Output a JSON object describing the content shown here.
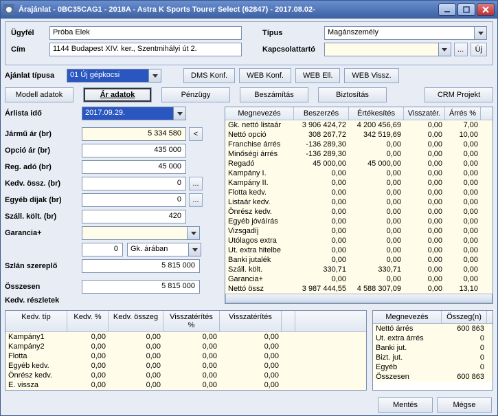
{
  "window": {
    "title": "Árajánlat - 0BC35CAG1 - 2018A - Astra K Sports Tourer Select (62847) - 2017.08.02-"
  },
  "top": {
    "customer_label": "Ügyfél",
    "customer_value": "Próba Elek",
    "address_label": "Cím",
    "address_value": "1144 Budapest XIV. ker., Szentmihályi út 2.",
    "type_label": "Típus",
    "type_value": "Magánszemély",
    "contact_label": "Kapcsolattartó",
    "contact_value": "",
    "dots": "...",
    "new": "Új"
  },
  "ajrow": {
    "label": "Ajánlat típusa",
    "value": "01 Új gépkocsi",
    "buttons": [
      "DMS Konf.",
      "WEB Konf.",
      "WEB Ell.",
      "WEB Vissz."
    ]
  },
  "tabs": {
    "items": [
      "Modell adatok",
      "Ár adatok",
      "Pénzügy",
      "Beszámítás",
      "Biztosítás"
    ],
    "right": "CRM Projekt"
  },
  "left": {
    "arlista_label": "Árlista idő",
    "arlista_value": "2017.09.29.",
    "fields": [
      {
        "label": "Jármű ár (br)",
        "value": "5 334 580",
        "extra": "<"
      },
      {
        "label": "Opció ár (br)",
        "value": "435 000"
      },
      {
        "label": "Reg. adó (br)",
        "value": "45 000"
      },
      {
        "label": "Kedv. össz. (br)",
        "value": "0",
        "extra": "..."
      },
      {
        "label": "Egyéb díjak (br)",
        "value": "0",
        "extra": "..."
      },
      {
        "label": "Száll. költ. (br)",
        "value": "420"
      }
    ],
    "garancia_label": "Garancia+",
    "garancia_value": "",
    "garancia_num": "0",
    "garancia_combo": "Gk. árában",
    "szlan_label": "Szlán szereplő",
    "szlan_value": "5 815 000",
    "ossz_label": "Összesen",
    "ossz_value": "5 815 000",
    "kedv_label": "Kedv. részletek"
  },
  "grid": {
    "headers": [
      "Megnevezés",
      "Beszerzés",
      "Értékesítés",
      "Visszatér.",
      "Árrés %"
    ],
    "rows": [
      [
        "Gk. nettó listaár",
        "3 906 424,72",
        "4 200 456,69",
        "0,00",
        "7,00"
      ],
      [
        "Nettó opció",
        "308 267,72",
        "342 519,69",
        "0,00",
        "10,00"
      ],
      [
        "Franchise árrés",
        "-136 289,30",
        "0,00",
        "0,00",
        "0,00"
      ],
      [
        "Minőségi árrés",
        "-136 289,30",
        "0,00",
        "0,00",
        "0,00"
      ],
      [
        "Regadó",
        "45 000,00",
        "45 000,00",
        "0,00",
        "0,00"
      ],
      [
        "Kampány I.",
        "0,00",
        "0,00",
        "0,00",
        "0,00"
      ],
      [
        "Kampány II.",
        "0,00",
        "0,00",
        "0,00",
        "0,00"
      ],
      [
        "Flotta kedv.",
        "0,00",
        "0,00",
        "0,00",
        "0,00"
      ],
      [
        "Listaár kedv.",
        "0,00",
        "0,00",
        "0,00",
        "0,00"
      ],
      [
        "Önrész kedv.",
        "0,00",
        "0,00",
        "0,00",
        "0,00"
      ],
      [
        "Egyéb jóváírás",
        "0,00",
        "0,00",
        "0,00",
        "0,00"
      ],
      [
        "Vizsgadíj",
        "0,00",
        "0,00",
        "0,00",
        "0,00"
      ],
      [
        "Utólagos extra",
        "0,00",
        "0,00",
        "0,00",
        "0,00"
      ],
      [
        "Ut. extra hitelbe",
        "0,00",
        "0,00",
        "0,00",
        "0,00"
      ],
      [
        "Banki jutalék",
        "0,00",
        "0,00",
        "0,00",
        "0,00"
      ],
      [
        "Száll. költ.",
        "330,71",
        "330,71",
        "0,00",
        "0,00"
      ],
      [
        "Garancia+",
        "0,00",
        "0,00",
        "0,00",
        "0,00"
      ],
      [
        "Nettó össz",
        "3 987 444,55",
        "4 588 307,09",
        "0,00",
        "13,10"
      ]
    ]
  },
  "kedv": {
    "headers": [
      "Kedv. típ",
      "Kedv. %",
      "Kedv. összeg",
      "Visszatérítés %",
      "Visszatérítés",
      ""
    ],
    "rows": [
      [
        "Kampány1",
        "0,00",
        "0,00",
        "0,00",
        "0,00",
        ""
      ],
      [
        "Kampány2",
        "0,00",
        "0,00",
        "0,00",
        "0,00",
        ""
      ],
      [
        "Flotta",
        "0,00",
        "0,00",
        "0,00",
        "0,00",
        ""
      ],
      [
        "Egyéb kedv.",
        "0,00",
        "0,00",
        "0,00",
        "0,00",
        ""
      ],
      [
        "Önrész kedv.",
        "0,00",
        "0,00",
        "0,00",
        "0,00",
        ""
      ],
      [
        "E. vissza",
        "0,00",
        "0,00",
        "0,00",
        "0,00",
        ""
      ]
    ]
  },
  "sum": {
    "headers": [
      "Megnevezés",
      "Összeg(n)"
    ],
    "rows": [
      [
        "Nettó árrés",
        "600 863"
      ],
      [
        "Ut. extra árrés",
        "0"
      ],
      [
        "Banki jut.",
        "0"
      ],
      [
        "Bizt. jut.",
        "0"
      ],
      [
        "Egyéb",
        "0"
      ],
      [
        "Összesen",
        "600 863"
      ]
    ]
  },
  "footer": {
    "save": "Mentés",
    "cancel": "Mégse"
  }
}
